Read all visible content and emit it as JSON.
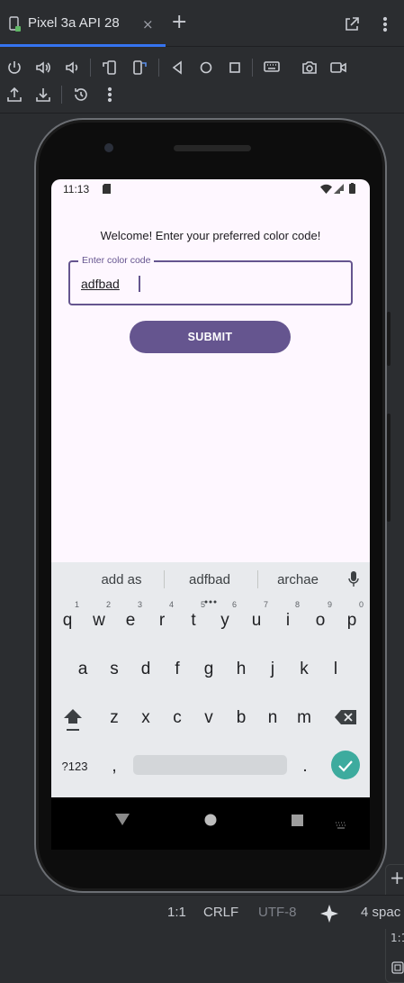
{
  "tab": {
    "title": "Pixel 3a API 28",
    "close": "×",
    "add": "+"
  },
  "toolbar": {
    "row1": [
      "power-icon",
      "volume-up-icon",
      "volume-down-icon",
      "rotate-left-icon",
      "rotate-right-icon",
      "back-icon",
      "home-icon",
      "overview-icon",
      "keyboard-icon",
      "camera-icon",
      "video-icon"
    ],
    "row2": [
      "export-icon",
      "import-icon",
      "snapshot-history-icon",
      "more-icon"
    ]
  },
  "device": {
    "clock": "11:13",
    "welcome": "Welcome! Enter your preferred color code!",
    "field_label": "Enter color code",
    "field_value": "adfbad",
    "submit": "SUBMIT"
  },
  "keyboard": {
    "suggestions": [
      "add as",
      "adfbad",
      "archae"
    ],
    "row1": [
      "q",
      "w",
      "e",
      "r",
      "t",
      "y",
      "u",
      "i",
      "o",
      "p"
    ],
    "row1_hints": [
      "1",
      "2",
      "3",
      "4",
      "5",
      "6",
      "7",
      "8",
      "9",
      "0"
    ],
    "row2": [
      "a",
      "s",
      "d",
      "f",
      "g",
      "h",
      "j",
      "k",
      "l"
    ],
    "row3": [
      "z",
      "x",
      "c",
      "v",
      "b",
      "n",
      "m"
    ],
    "sym": "?123",
    "comma": ",",
    "period": "."
  },
  "right_panel": {
    "plus": "+",
    "ratio": "1:1"
  },
  "ide_status": {
    "position": "1:1",
    "line_sep": "CRLF",
    "encoding": "UTF-8",
    "indent": "4 spac"
  },
  "colors": {
    "accent": "#65558f",
    "screen_bg": "#fef7ff",
    "ide_bg": "#2b2d30",
    "enter_key": "#3dab9e",
    "tab_underline": "#3574f0"
  }
}
